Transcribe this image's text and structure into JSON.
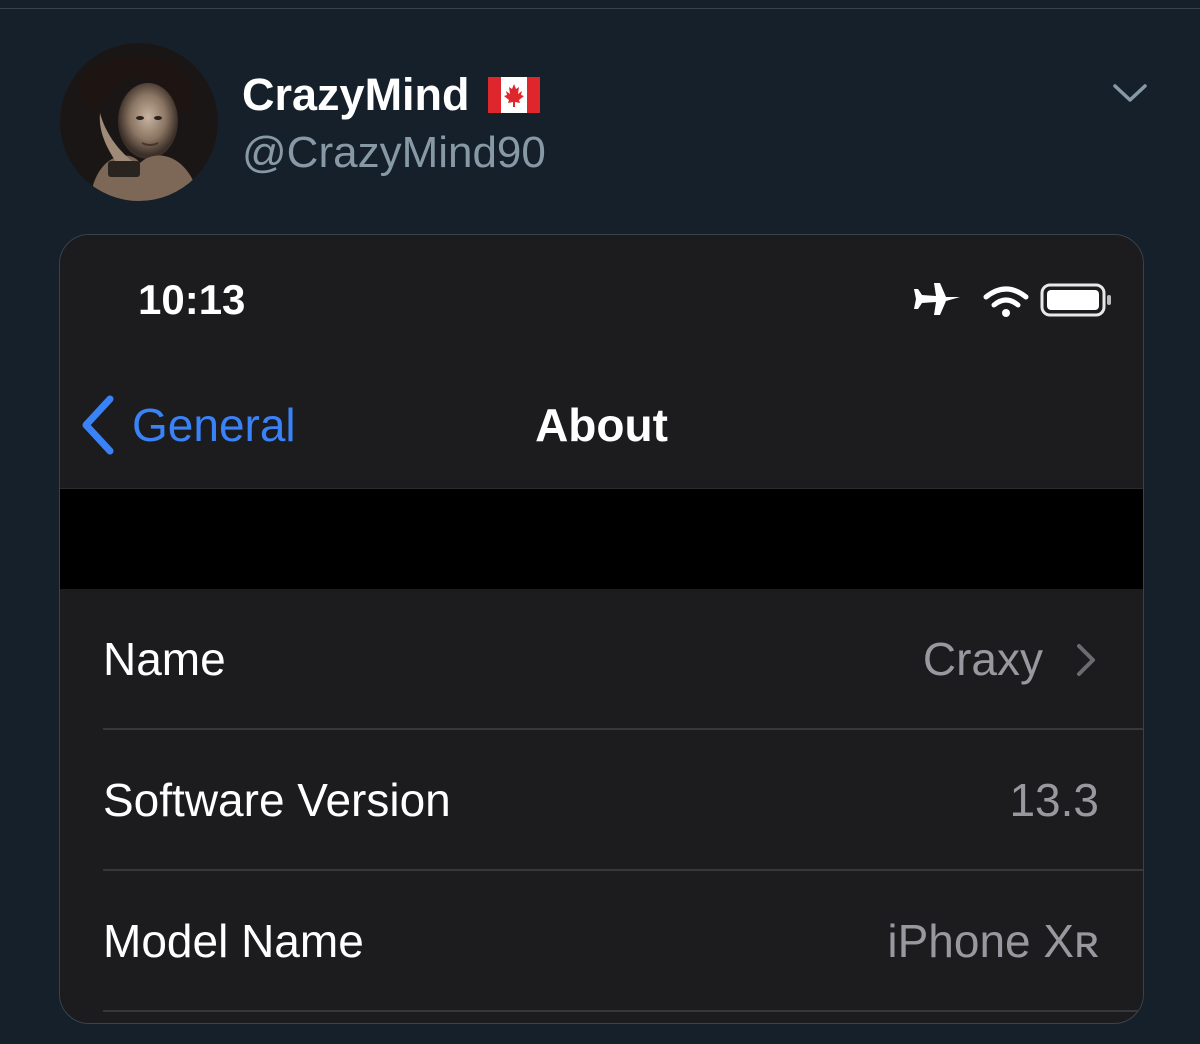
{
  "tweet": {
    "display_name": "CrazyMind",
    "handle": "@CrazyMind90",
    "flag_icon": "canada-flag-icon",
    "menu_icon": "chevron-down-icon"
  },
  "phone": {
    "status_bar": {
      "time": "10:13",
      "icons": [
        "airplane-mode-icon",
        "wifi-icon",
        "battery-icon"
      ]
    },
    "nav": {
      "back_label": "General",
      "title": "About"
    },
    "rows": [
      {
        "label": "Name",
        "value": "Craxy",
        "chevron": true
      },
      {
        "label": "Software Version",
        "value": "13.3",
        "chevron": false
      },
      {
        "label": "Model Name",
        "value": "iPhone Xʀ",
        "chevron": false
      }
    ]
  },
  "colors": {
    "twitter_bg": "#15202b",
    "ios_blue": "#3a82f7",
    "ios_cell_bg": "#1c1c1e"
  }
}
